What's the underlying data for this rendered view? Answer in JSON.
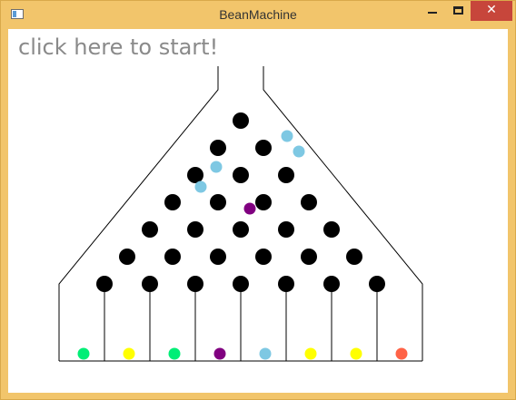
{
  "window": {
    "title": "BeanMachine",
    "close_glyph": "✕",
    "icons": {
      "minimize": "minimize-icon",
      "maximize": "maximize-icon",
      "close": "close-icon",
      "app": "app-icon"
    }
  },
  "canvas": {
    "start_label": "click here to start!"
  },
  "colors": {
    "frame": "#f2c56b",
    "peg": "#000000",
    "line": "#000000",
    "ball_light_blue": "#7ec8e3",
    "ball_purple": "#800080",
    "ball_green": "#00ee76",
    "ball_yellow": "#ffff00",
    "ball_red": "#ff6347"
  },
  "machine": {
    "peg_rows": 7,
    "slots": 8,
    "falling_ball_colors": [
      "ball_light_blue",
      "ball_light_blue",
      "ball_light_blue",
      "ball_light_blue",
      "ball_purple"
    ],
    "slot_ball_colors": [
      "ball_green",
      "ball_yellow",
      "ball_green",
      "ball_purple",
      "ball_light_blue",
      "ball_yellow",
      "ball_yellow",
      "ball_red"
    ]
  }
}
